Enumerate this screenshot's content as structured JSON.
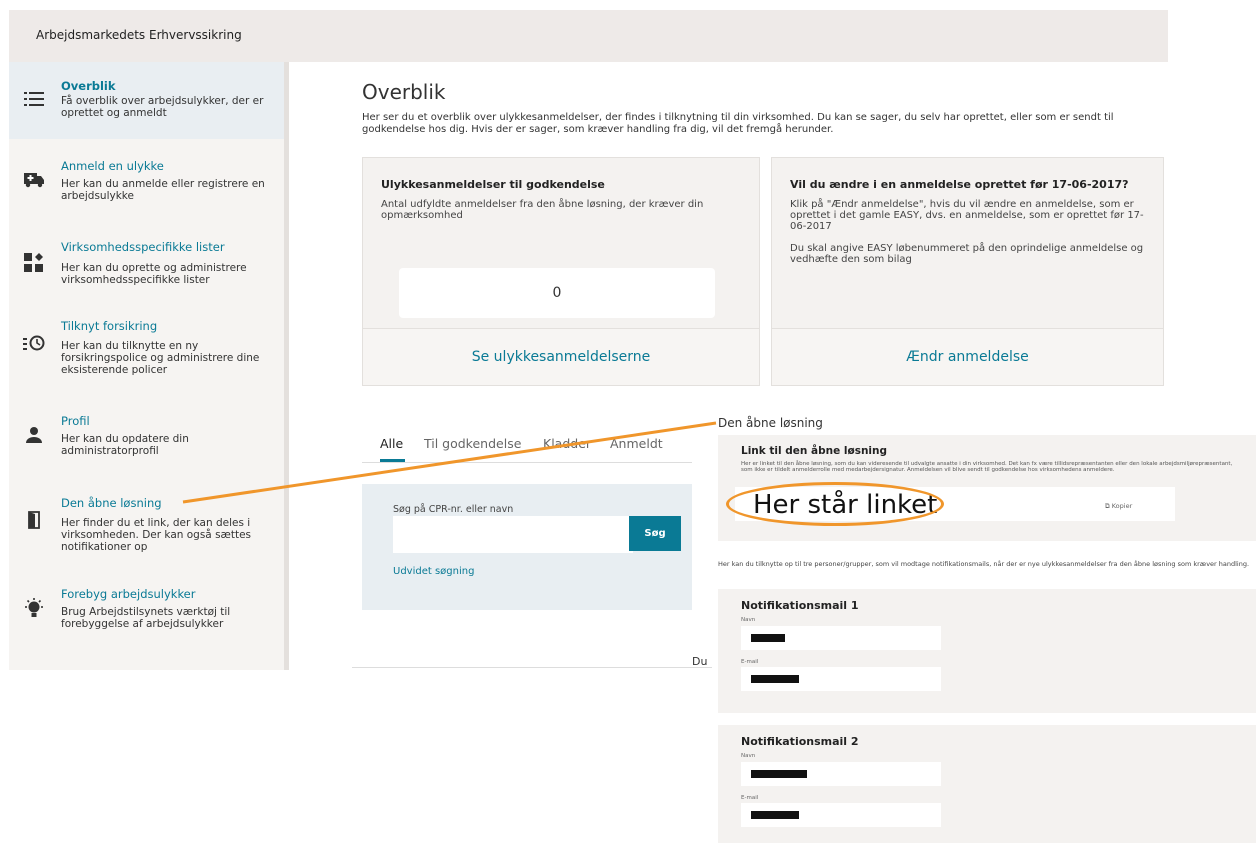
{
  "app": {
    "title": "Arbejdsmarkedets Erhvervssikring"
  },
  "sidebar": {
    "items": [
      {
        "icon": "list-icon",
        "label": "Overblik",
        "desc": "Få overblik over arbejdsulykker, der er oprettet og anmeldt"
      },
      {
        "icon": "ambulance-icon",
        "label": "Anmeld en ulykke",
        "desc": "Her kan du anmelde eller registrere en arbejdsulykke"
      },
      {
        "icon": "widgets-icon",
        "label": "Virksomhedsspecifikke lister",
        "desc": "Her kan du oprette og administrere virksomhedsspecifikke lister"
      },
      {
        "icon": "clock-list-icon",
        "label": "Tilknyt forsikring",
        "desc": "Her kan du tilknytte en ny forsikringspolice og administrere dine eksisterende policer"
      },
      {
        "icon": "person-icon",
        "label": "Profil",
        "desc": "Her kan du opdatere din administratorprofil"
      },
      {
        "icon": "door-icon",
        "label": "Den åbne løsning",
        "desc": "Her finder du et link, der kan deles i virksomheden. Der kan også sættes notifikationer op"
      },
      {
        "icon": "lightbulb-icon",
        "label": "Forebyg arbejdsulykker",
        "desc": "Brug Arbejdstilsynets værktøj til forebyggelse af arbejdsulykker"
      }
    ]
  },
  "main": {
    "title": "Overblik",
    "intro": "Her ser du et overblik over ulykkesanmeldelser, der findes i tilknytning til din virksomhed. Du kan se sager, du selv har oprettet, eller som er sendt til godkendelse hos dig. Hvis der er sager, som kræver handling fra dig, vil det fremgå herunder.",
    "card1": {
      "title": "Ulykkesanmeldelser til godkendelse",
      "desc": "Antal udfyldte anmeldelser fra den åbne løsning, der kræver din opmærksomhed",
      "count": "0",
      "action": "Se ulykkesanmeldelserne"
    },
    "card2": {
      "title": "Vil du ændre i en anmeldelse oprettet før 17-06-2017?",
      "desc1": "Klik på \"Ændr anmeldelse\", hvis du vil ændre en anmeldelse, som er oprettet i det gamle EASY, dvs. en anmeldelse, som er oprettet før 17-06-2017",
      "desc2": "Du skal angive EASY løbenummeret på den oprindelige anmeldelse og vedhæfte den som bilag",
      "action": "Ændr anmeldelse"
    },
    "tabs": [
      "Alle",
      "Til godkendelse",
      "Kladder",
      "Anmeldt"
    ],
    "search": {
      "label": "Søg på CPR-nr. eller navn",
      "button": "Søg",
      "advanced": "Udvidet søgning"
    },
    "footer_text": "Du"
  },
  "overlay": {
    "title": "Den åbne løsning",
    "link_panel": {
      "title": "Link til den åbne løsning",
      "desc": "Her er linket til den åbne løsning, som du kan videresende til udvalgte ansatte i din virksomhed. Det kan fx være tillidsrepræsentanten eller den lokale arbejdsmiljørepræsentant, som ikke er tildelt anmelderrolle med medarbejdersignatur. Anmeldelsen vil blive sendt til godkendelse hos virksomhedens anmeldere.",
      "link_text": "Her står linket",
      "copy_label": "Kopier"
    },
    "notif_intro": "Her kan du tilknytte op til tre personer/grupper, som vil modtage notifikationsmails, når der er nye ulykkesanmeldelser fra den åbne løsning som kræver handling.",
    "notifications": [
      {
        "title": "Notifikationsmail 1",
        "name_label": "Navn",
        "email_label": "E-mail"
      },
      {
        "title": "Notifikationsmail 2",
        "name_label": "Navn",
        "email_label": "E-mail"
      }
    ]
  },
  "colors": {
    "accent": "#0a7a95",
    "highlight": "#f0962b",
    "panel": "#f4f2f0"
  }
}
